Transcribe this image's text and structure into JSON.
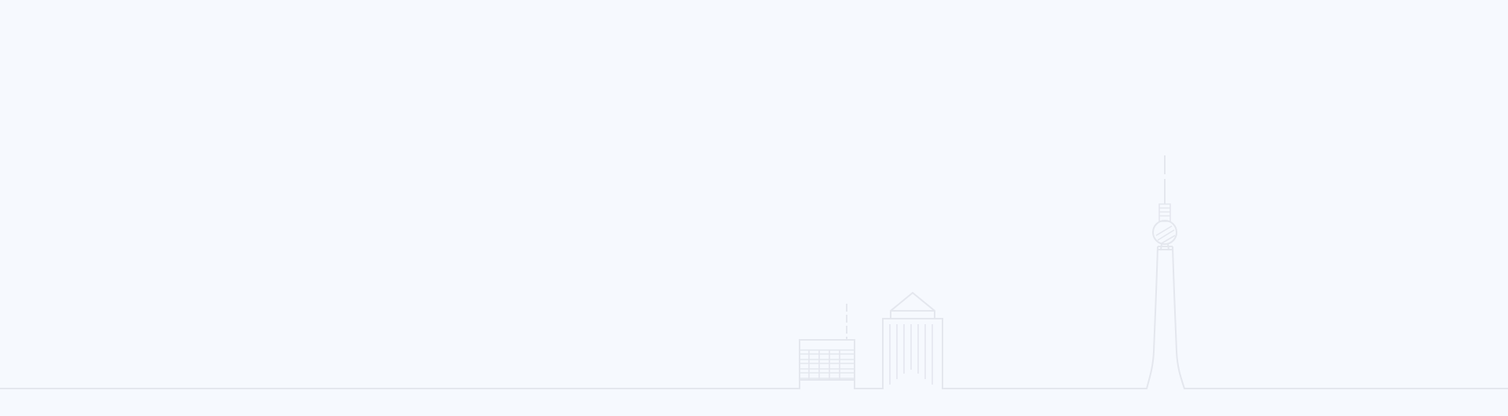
{
  "background_color": "#f6f9fe",
  "line_color": "#e4e7ee",
  "illustration": {
    "elements": [
      "ground-line",
      "office-building",
      "skyscraper",
      "tv-tower-icon"
    ]
  }
}
